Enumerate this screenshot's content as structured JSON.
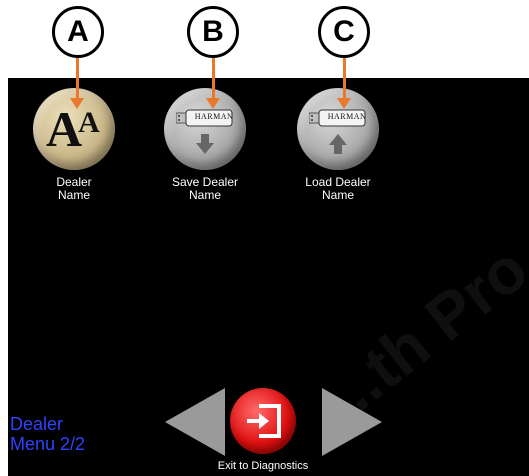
{
  "callouts": [
    {
      "letter": "A"
    },
    {
      "letter": "B"
    },
    {
      "letter": "C"
    }
  ],
  "buttons": [
    {
      "line1": "Dealer",
      "line2": "Name",
      "glyph": "A",
      "glyph_small": "A",
      "icon": "font-size-icon"
    },
    {
      "line1": "Save Dealer",
      "line2": "Name",
      "brand": "HARMAN",
      "icon": "usb-save-icon"
    },
    {
      "line1": "Load Dealer",
      "line2": "Name",
      "brand": "HARMAN",
      "icon": "usb-load-icon"
    }
  ],
  "menu": {
    "line1": "Dealer",
    "line2": "Menu 2/2"
  },
  "exit": {
    "label": "Exit to Diagnostics",
    "icon": "exit-door-icon"
  },
  "nav": {
    "prev_icon": "prev-arrow-icon",
    "next_icon": "next-arrow-icon"
  },
  "watermark": "...th Pro",
  "colors": {
    "callout_arrow": "#e8792a",
    "menu_text": "#2f43ff",
    "exit_button": "#e01010",
    "dealer_name_button": "#cbb88a",
    "usb_buttons": "#ababab"
  }
}
